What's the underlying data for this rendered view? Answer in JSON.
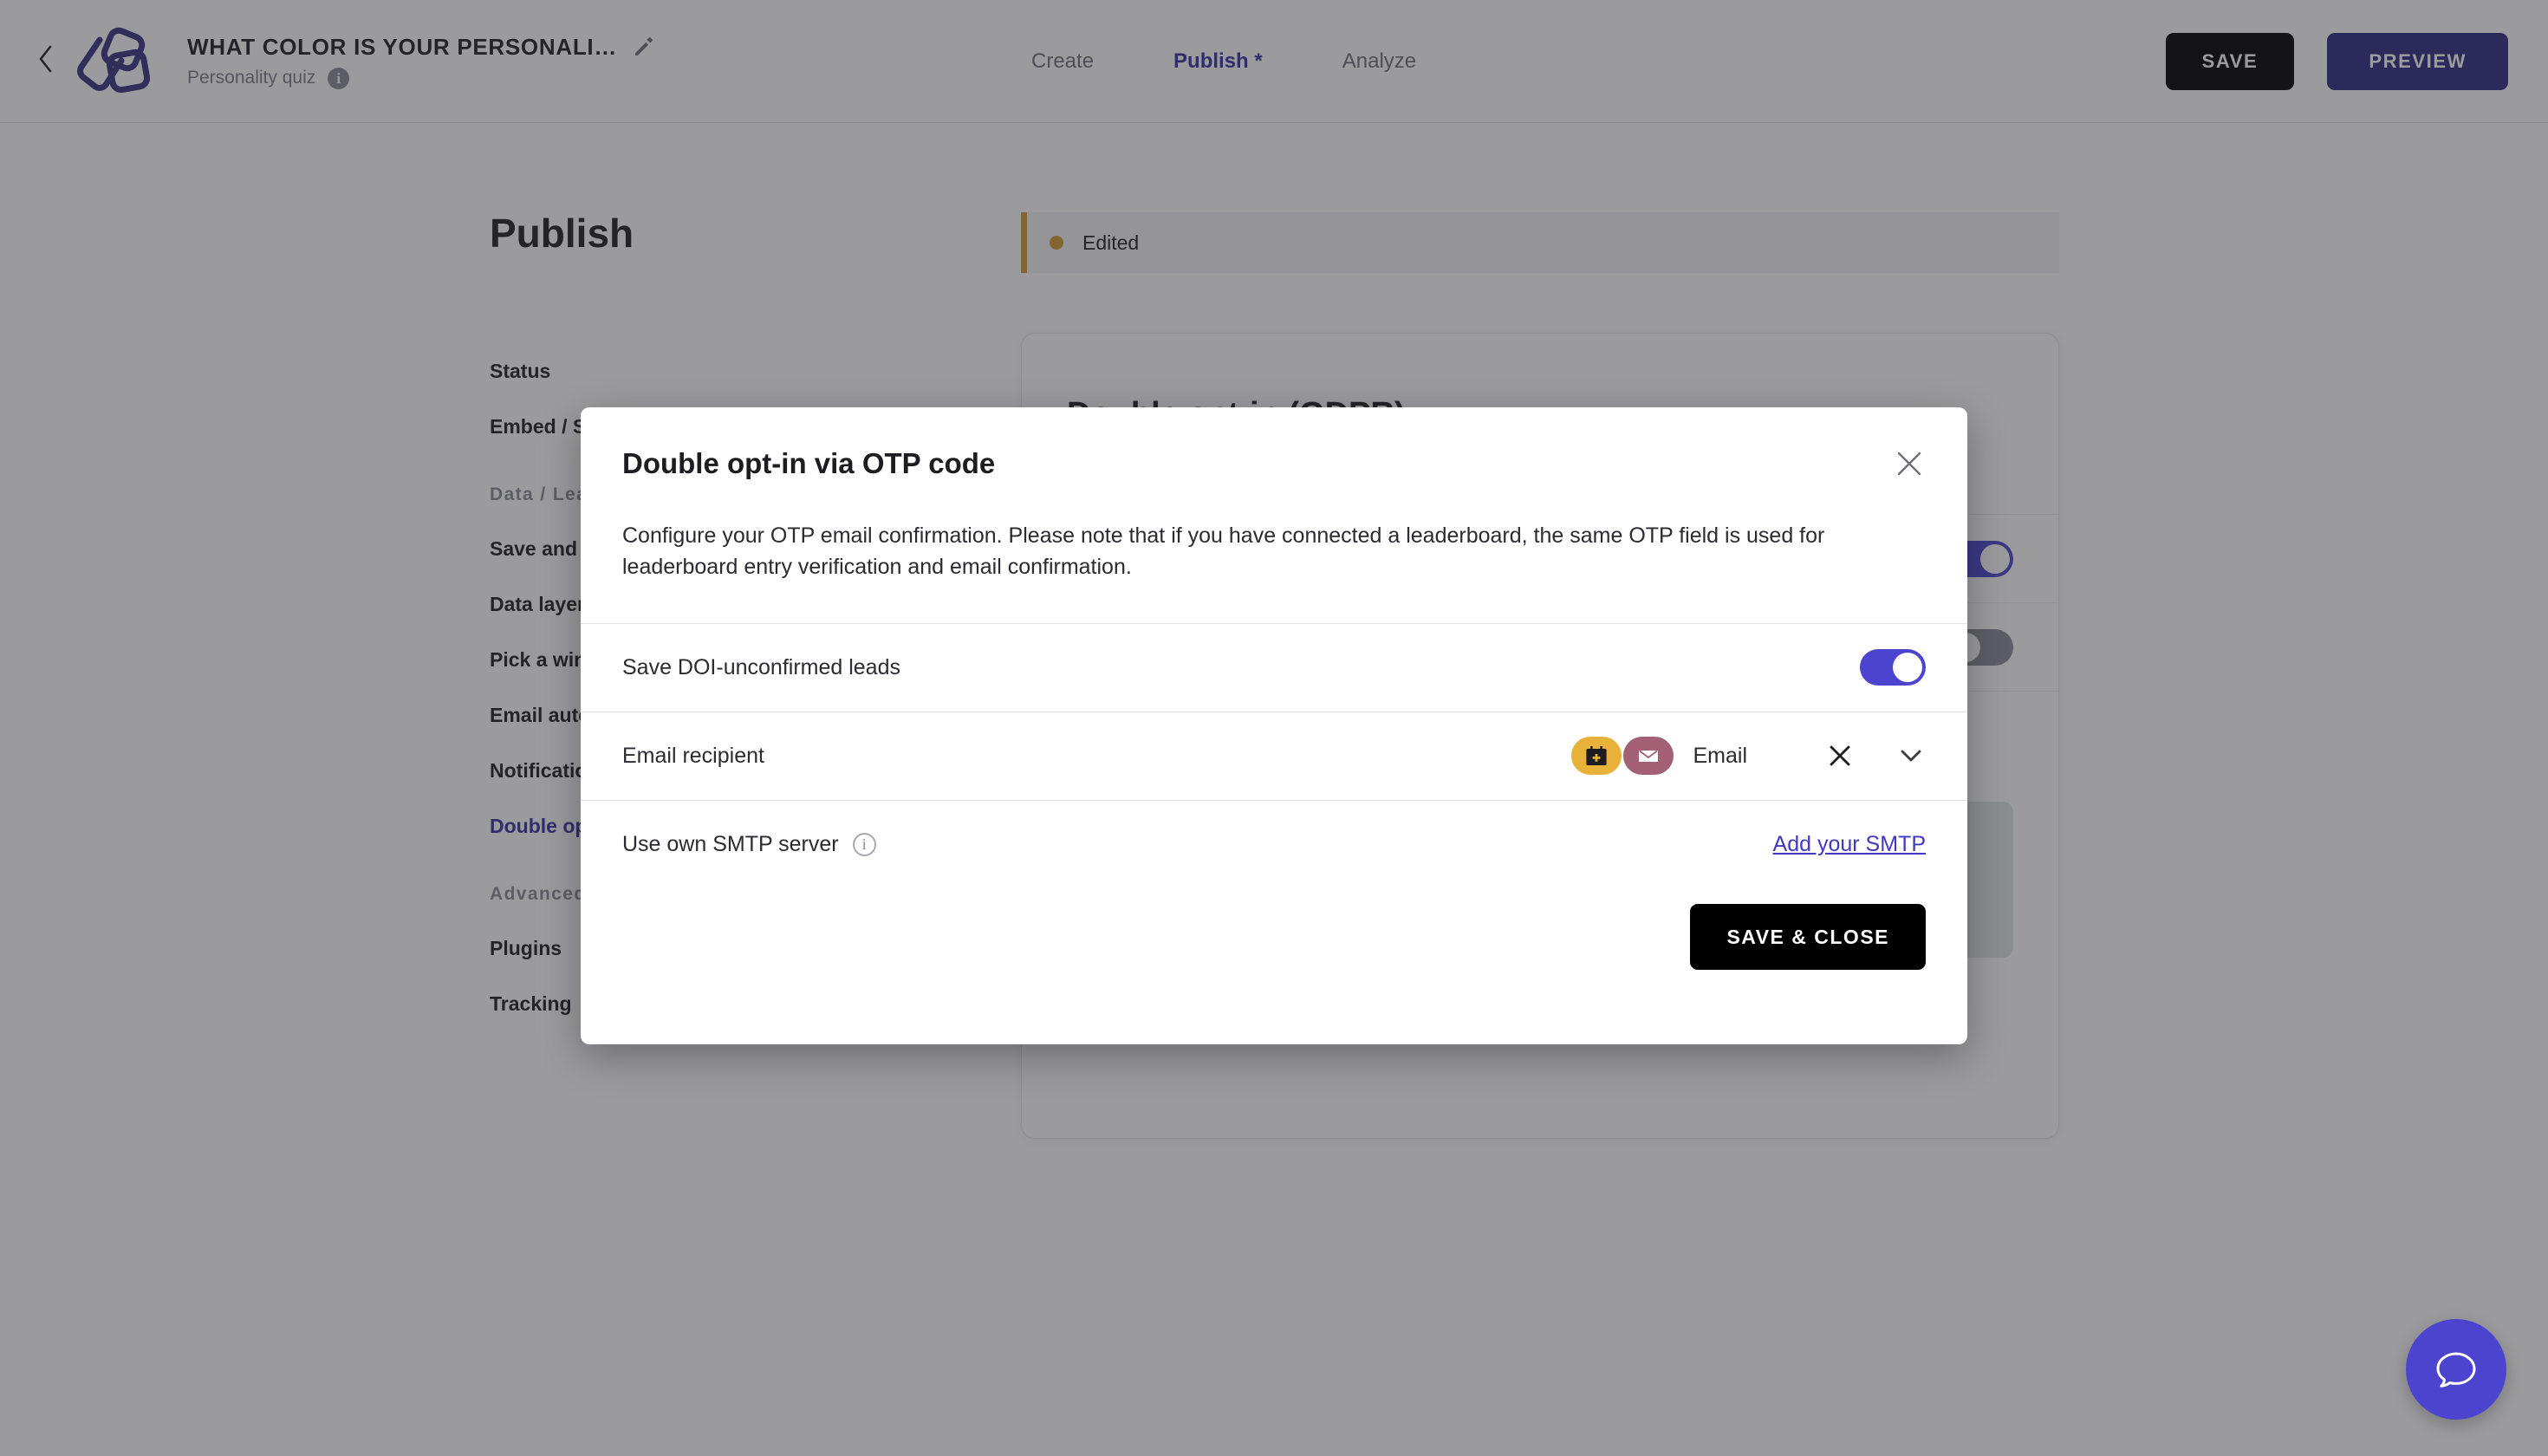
{
  "topbar": {
    "back_icon": "chevron-left-icon",
    "logo_icon": "brand-logo-icon",
    "doc_title": "WHAT COLOR IS YOUR PERSONALI…",
    "edit_icon": "pencil-icon",
    "doc_subtitle": "Personality quiz",
    "info_icon": "info-icon",
    "nav": [
      {
        "label": "Create",
        "active": false
      },
      {
        "label": "Publish *",
        "active": true
      },
      {
        "label": "Analyze",
        "active": false
      }
    ],
    "save_label": "SAVE",
    "preview_label": "PREVIEW",
    "save_bg": "#000000",
    "preview_bg": "#2f2a80"
  },
  "page": {
    "title": "Publish",
    "side_nav": [
      {
        "label": "Status",
        "kind": "item",
        "active": false
      },
      {
        "label": "Embed / Share",
        "kind": "item",
        "active": false
      },
      {
        "label": "Data / Leads",
        "kind": "section",
        "active": false
      },
      {
        "label": "Save and export leads",
        "kind": "item",
        "active": false
      },
      {
        "label": "Data layer events",
        "kind": "item",
        "active": false
      },
      {
        "label": "Pick a winner",
        "kind": "item",
        "active": false
      },
      {
        "label": "Email automation",
        "kind": "item",
        "active": false
      },
      {
        "label": "Notifications",
        "kind": "item",
        "active": false
      },
      {
        "label": "Double opt-in (GDPR)",
        "kind": "item",
        "active": true
      },
      {
        "label": "Advanced",
        "kind": "section",
        "active": false
      },
      {
        "label": "Plugins",
        "kind": "item",
        "active": false
      },
      {
        "label": "Tracking",
        "kind": "item",
        "active": false
      }
    ]
  },
  "status_strip": {
    "text": "Edited",
    "dot_color": "#d19a33",
    "accent_color": "#d19a33"
  },
  "detail_card": {
    "heading": "Double opt-in (GDPR)",
    "rows": [
      {
        "label": "",
        "toggle": "on"
      },
      {
        "label": "",
        "toggle": "off"
      },
      {
        "label": "",
        "toggle": "none"
      }
    ]
  },
  "modal": {
    "title": "Double opt-in via OTP code",
    "close_icon": "close-icon",
    "description": "Configure your OTP email confirmation. Please note that if you have connected a leaderboard, the same OTP field is used for leaderboard entry verification and email confirmation.",
    "row_save_doi": {
      "label": "Save DOI-unconfirmed leads",
      "toggle_state": "on",
      "toggle_color": "#4c44cf"
    },
    "row_recipient": {
      "label": "Email recipient",
      "chip_calendar_icon": "calendar-plus-icon",
      "chip_calendar_color": "#e8b23a",
      "chip_envelope_icon": "envelope-icon",
      "chip_envelope_color": "#a35f74",
      "value": "Email",
      "clear_icon": "close-icon",
      "chevron_icon": "chevron-down-icon"
    },
    "row_smtp": {
      "label": "Use own SMTP server",
      "info_icon": "info-icon",
      "link_label": "Add your SMTP",
      "link_color": "#4038c2"
    },
    "save_close_label": "SAVE & CLOSE"
  },
  "chat_fab": {
    "icon": "chat-bubble-icon",
    "color": "#4c44cf"
  }
}
